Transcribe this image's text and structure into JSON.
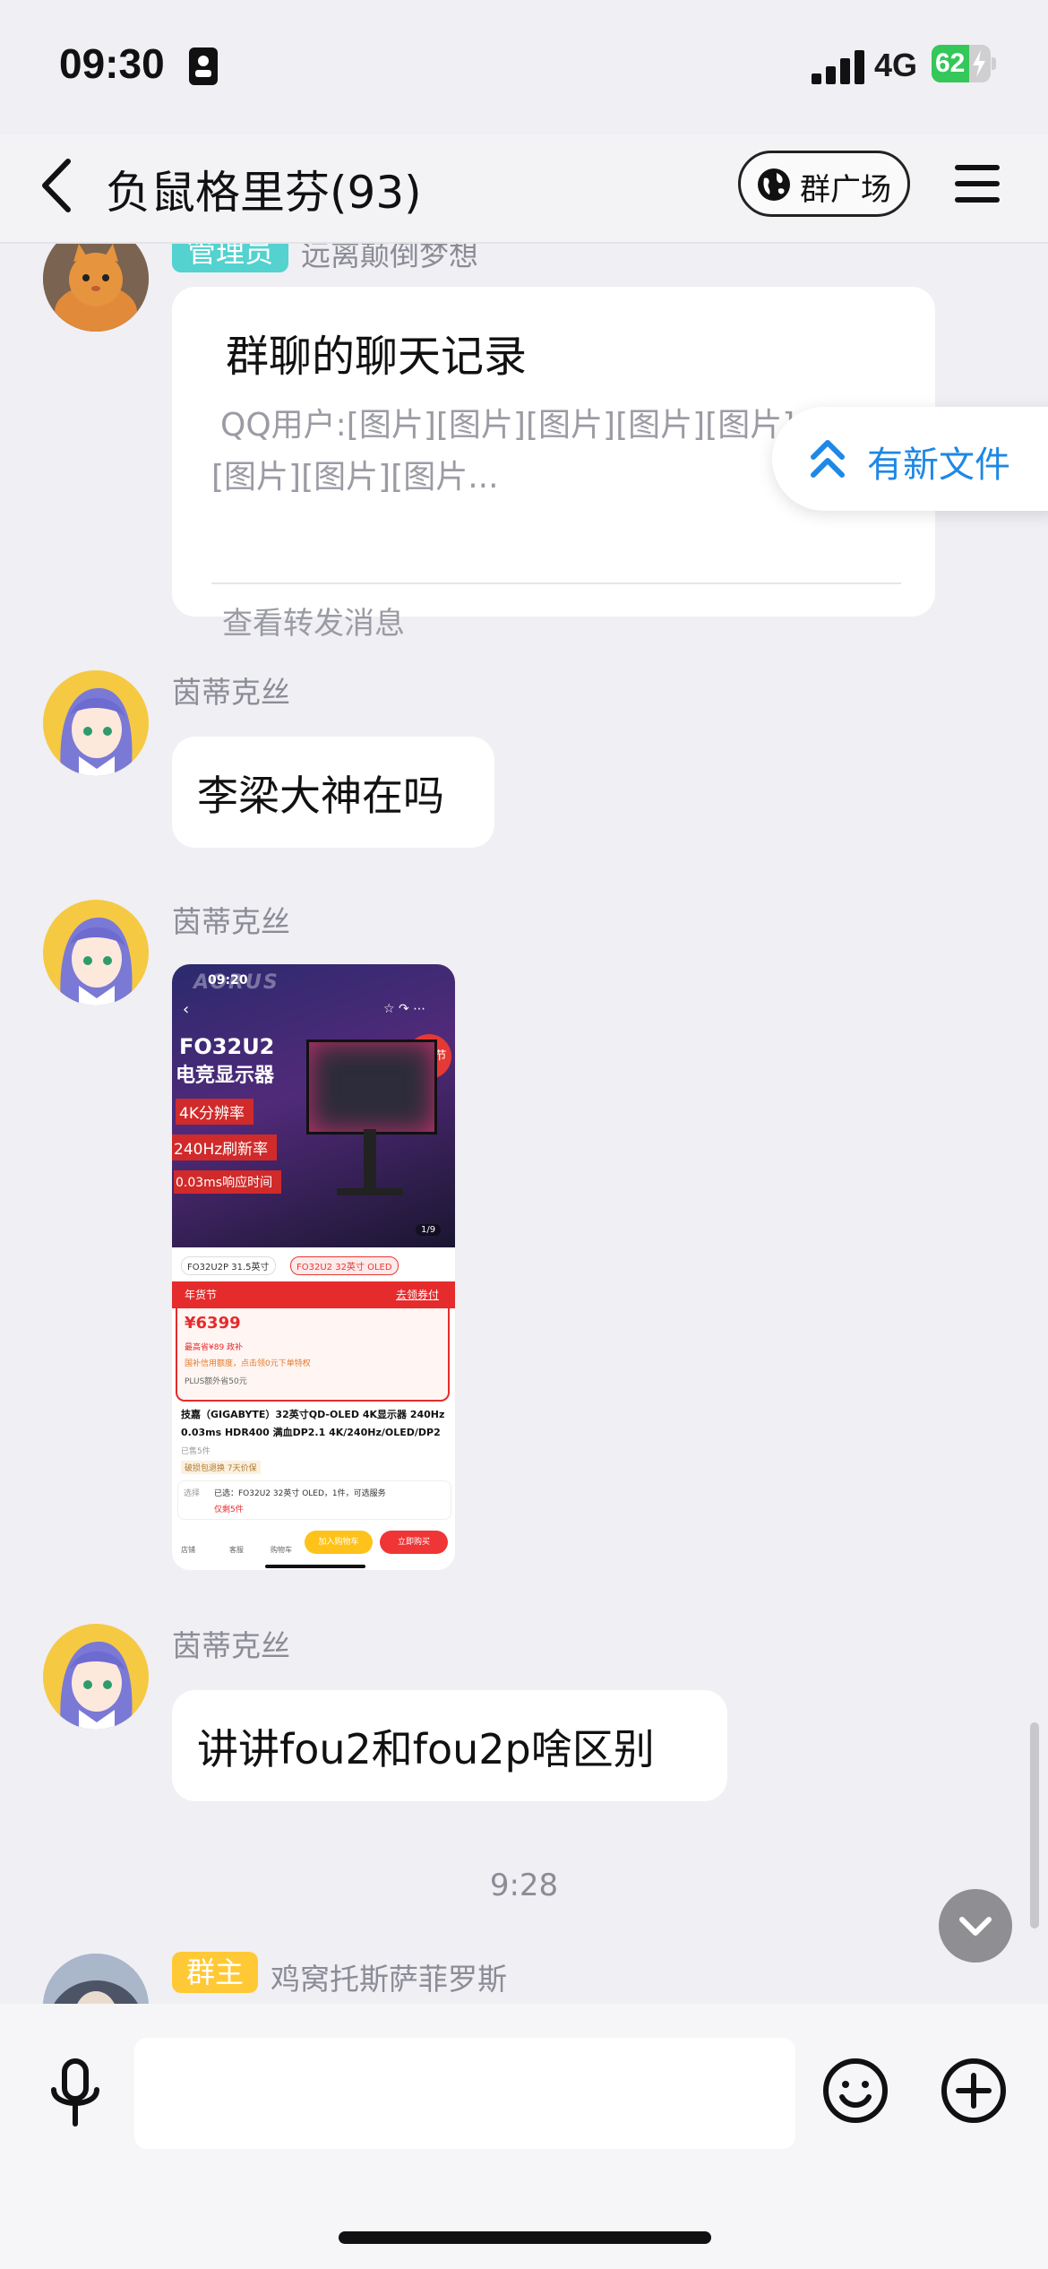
{
  "status_bar": {
    "time": "09:30",
    "network": "4G",
    "battery": "62"
  },
  "nav": {
    "title": "负鼠格里芬(93)",
    "plaza_label": "群广场"
  },
  "new_file": {
    "label": "有新文件"
  },
  "messages": {
    "card": {
      "role_badge": "管理员",
      "sender": "远离颠倒梦想",
      "title": "群聊的聊天记录",
      "preview_line1": "QQ用户:[图片][图片][图片][图片][图片]",
      "preview_line2": "[图片][图片][图片...",
      "link": "查看转发消息"
    },
    "msg1": {
      "sender": "茵蒂克丝",
      "text": "李梁大神在吗"
    },
    "msg2": {
      "sender": "茵蒂克丝",
      "image": {
        "time": "09:20",
        "brand": "AORUS",
        "model": "FO32U2",
        "subtitle": "电竞显示器",
        "feature1": "4K分辨率",
        "feature2": "240Hz刷新率",
        "feature3": "0.03ms响应时间",
        "tag": "年货节",
        "page": "1/9",
        "variant1": "FO32U2P 31.5英寸",
        "variant2": "FO32U2 32英寸 OLED",
        "promo": "年货节",
        "promo_link": "去领券付",
        "price": "¥6399",
        "price_note1": "最高省¥89 政补",
        "price_note2": "国补信用额度，点击领0元下单特权",
        "price_note3": "PLUS额外省50元",
        "desc1": "技嘉（GIGABYTE）32英寸QD-OLED 4K显示器 240Hz",
        "desc2": "0.03ms HDR400 满血DP2.1 4K/240Hz/OLED/DP2",
        "sold": "已售5件",
        "warranty": "破损包退换  7天价保",
        "select_label": "选择",
        "selected": "已选：FO32U2 32英寸 OLED，1件，可选服务",
        "stock": "仅剩5件",
        "tab1": "店铺",
        "tab2": "客服",
        "tab3": "购物车",
        "add_cart": "加入购物车",
        "buy_now": "立即购买"
      }
    },
    "msg3": {
      "sender": "茵蒂克丝",
      "text": "讲讲fou2和fou2p啥区别"
    },
    "time_divider": "9:28",
    "owner": {
      "role_badge": "群主",
      "sender": "鸡窝托斯萨菲罗斯"
    }
  },
  "input": {
    "placeholder": ""
  },
  "colors": {
    "accent": "#1e88e5",
    "admin_badge": "#53d2cf",
    "owner_badge": "#ffc936"
  }
}
